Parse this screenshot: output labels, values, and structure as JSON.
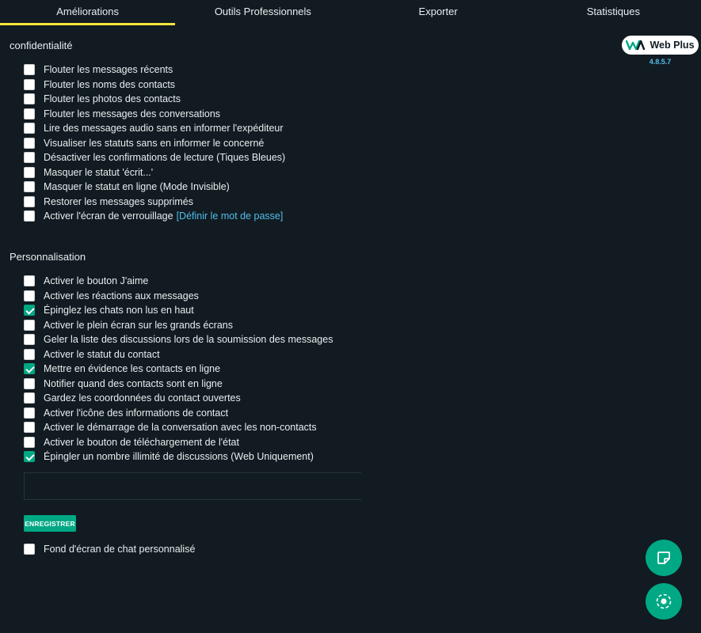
{
  "tabs": [
    "Améliorations",
    "Outils Professionnels",
    "Exporter",
    "Statistiques"
  ],
  "active_tab": 0,
  "brand": {
    "name": "Web Plus",
    "version": "4.8.5.7"
  },
  "privacy": {
    "title": "confidentialité",
    "options": [
      {
        "label": "Flouter les messages récents",
        "checked": false
      },
      {
        "label": "Flouter les noms des contacts",
        "checked": false
      },
      {
        "label": "Flouter les photos des contacts",
        "checked": false
      },
      {
        "label": "Flouter les messages des conversations",
        "checked": false
      },
      {
        "label": "Lire des messages audio sans en informer l'expéditeur",
        "checked": false
      },
      {
        "label": "Visualiser les statuts sans en informer le concerné",
        "checked": false
      },
      {
        "label": "Désactiver les confirmations de lecture (Tiques Bleues)",
        "checked": false
      },
      {
        "label": "Masquer le statut 'écrit...'",
        "checked": false
      },
      {
        "label": "Masquer le statut en ligne (Mode Invisible)",
        "checked": false
      },
      {
        "label": "Restorer les messages supprimés",
        "checked": false
      },
      {
        "label": "Activer l'écran de verrouillage",
        "checked": false,
        "link": "[Définir le mot de passe]"
      }
    ]
  },
  "customization": {
    "title": "Personnalisation",
    "options": [
      {
        "label": "Activer le bouton J'aime",
        "checked": false
      },
      {
        "label": "Activer les réactions aux messages",
        "checked": false
      },
      {
        "label": "Épinglez les chats non lus en haut",
        "checked": true
      },
      {
        "label": "Activer le plein écran sur les grands écrans",
        "checked": false
      },
      {
        "label": "Geler la liste des discussions lors de la soumission des messages",
        "checked": false
      },
      {
        "label": "Activer le statut du contact",
        "checked": false
      },
      {
        "label": "Mettre en évidence les contacts en ligne",
        "checked": true
      },
      {
        "label": "Notifier quand des contacts sont en ligne",
        "checked": false
      },
      {
        "label": "Gardez les coordonnées du contact ouvertes",
        "checked": false
      },
      {
        "label": "Activer l'icône des informations de contact",
        "checked": false
      },
      {
        "label": "Activer le démarrage de la conversation avec les non-contacts",
        "checked": false
      },
      {
        "label": "Activer le bouton de téléchargement de l'état",
        "checked": false
      },
      {
        "label": "Épingler un nombre illimité de discussions (Web Uniquement)",
        "checked": true
      }
    ]
  },
  "save_button": "ENREGISTRER",
  "wallpaper_option": {
    "label": "Fond d'écran de chat personnalisé",
    "checked": false
  },
  "fab_icons": [
    "sticky-note-icon",
    "status-ring-icon"
  ],
  "colors": {
    "background": "#111b21",
    "accent": "#00a884",
    "tab_underline": "#f5e43a",
    "link": "#53bdeb",
    "text": "#e9edef"
  }
}
